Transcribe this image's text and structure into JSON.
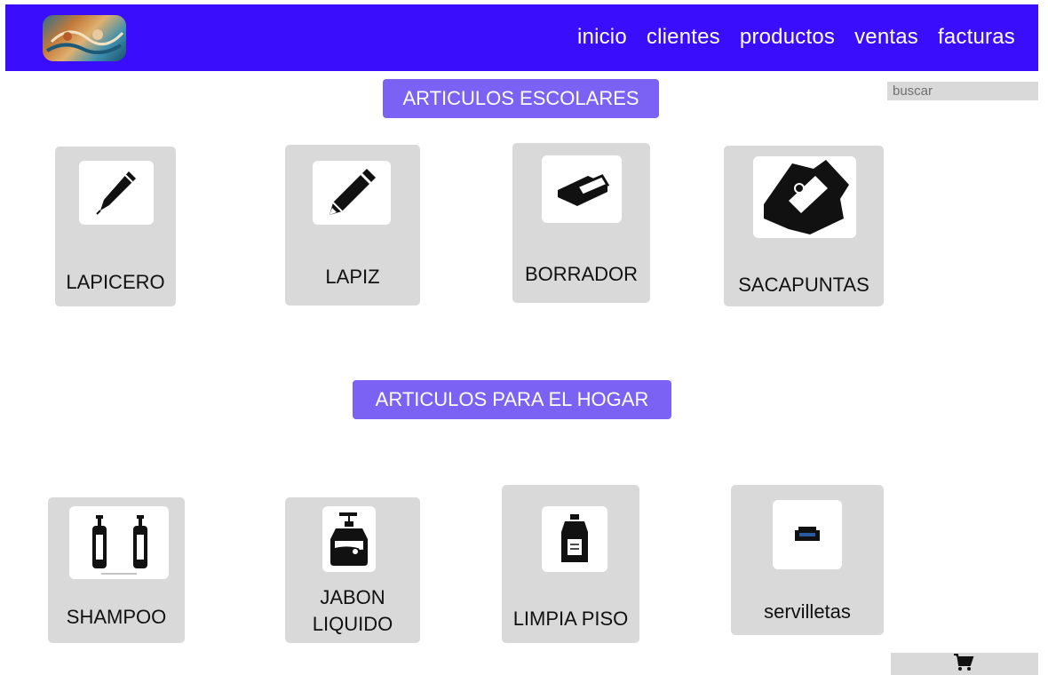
{
  "nav": {
    "links": [
      {
        "label": "inicio"
      },
      {
        "label": "clientes"
      },
      {
        "label": "productos"
      },
      {
        "label": "ventas"
      },
      {
        "label": "facturas"
      }
    ]
  },
  "search": {
    "placeholder": "buscar"
  },
  "sections": {
    "school": {
      "title": "ARTICULOS ESCOLARES",
      "products": [
        {
          "name": "LAPICERO",
          "icon": "pen-icon"
        },
        {
          "name": "LAPIZ",
          "icon": "pencil-icon"
        },
        {
          "name": "BORRADOR",
          "icon": "eraser-icon"
        },
        {
          "name": "SACAPUNTAS",
          "icon": "sharpener-icon"
        }
      ]
    },
    "home": {
      "title": "ARTICULOS PARA EL HOGAR",
      "products": [
        {
          "name": "SHAMPOO",
          "icon": "shampoo-bottles-icon"
        },
        {
          "name": "JABON\nLIQUIDO",
          "icon": "liquid-soap-icon"
        },
        {
          "name": "LIMPIA PISO",
          "icon": "floor-cleaner-icon"
        },
        {
          "name": "servilletas",
          "icon": "napkins-icon"
        }
      ]
    }
  },
  "cart": {
    "icon": "cart-icon"
  }
}
